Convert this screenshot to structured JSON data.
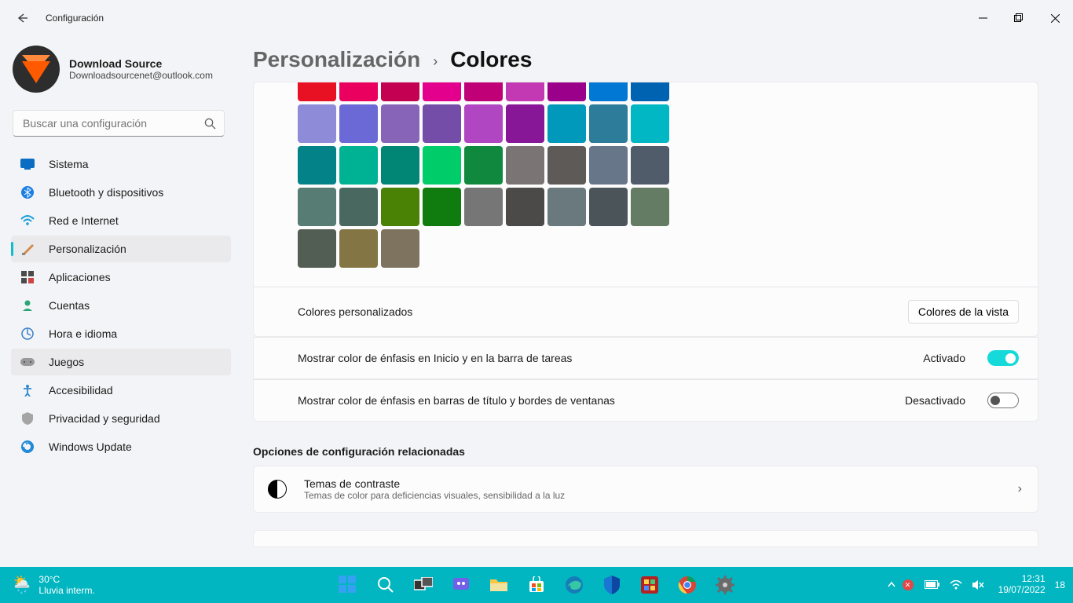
{
  "window": {
    "title": "Configuración"
  },
  "profile": {
    "name": "Download Source",
    "email": "Downloadsourcenet@outlook.com"
  },
  "search": {
    "placeholder": "Buscar una configuración"
  },
  "sidebar": {
    "items": [
      {
        "label": "Sistema"
      },
      {
        "label": "Bluetooth y dispositivos"
      },
      {
        "label": "Red e Internet"
      },
      {
        "label": "Personalización"
      },
      {
        "label": "Aplicaciones"
      },
      {
        "label": "Cuentas"
      },
      {
        "label": "Hora e idioma"
      },
      {
        "label": "Juegos"
      },
      {
        "label": "Accesibilidad"
      },
      {
        "label": "Privacidad y seguridad"
      },
      {
        "label": "Windows Update"
      }
    ]
  },
  "breadcrumb": {
    "parent": "Personalización",
    "current": "Colores"
  },
  "swatches": {
    "row0": [
      "#e81123",
      "#ea005e",
      "#c30052",
      "#e3008c",
      "#bf0077",
      "#c239b3",
      "#9a0089",
      "#0078d4",
      "#0063b1"
    ],
    "row1": [
      "#8e8cd8",
      "#6b69d6",
      "#8764b8",
      "#744da9",
      "#b146c2",
      "#881798",
      "#0099bc",
      "#2d7d9a",
      "#00b7c3"
    ],
    "row2": [
      "#038387",
      "#00b294",
      "#018574",
      "#00cc6a",
      "#10893e",
      "#7a7574",
      "#5d5a58",
      "#68768a",
      "#515c6b"
    ],
    "row3": [
      "#567c73",
      "#486860",
      "#498205",
      "#107c10",
      "#767676",
      "#4c4a48",
      "#69797e",
      "#4a5459",
      "#647c64"
    ],
    "row4": [
      "#525e54",
      "#847545",
      "#7e735f"
    ]
  },
  "settings": {
    "customColors": {
      "label": "Colores personalizados",
      "button": "Colores de la vista"
    },
    "accentStart": {
      "label": "Mostrar color de énfasis en Inicio y en la barra de tareas",
      "state": "Activado",
      "on": true
    },
    "accentTitle": {
      "label": "Mostrar color de énfasis en barras de título y bordes de ventanas",
      "state": "Desactivado",
      "on": false
    }
  },
  "related": {
    "title": "Opciones de configuración relacionadas",
    "contrast": {
      "title": "Temas de contraste",
      "sub": "Temas de color para deficiencias visuales, sensibilidad a la luz"
    }
  },
  "taskbar": {
    "temp": "30°C",
    "weather": "Lluvia interm.",
    "time": "12:31",
    "date": "19/07/2022",
    "notif_count": "18"
  }
}
